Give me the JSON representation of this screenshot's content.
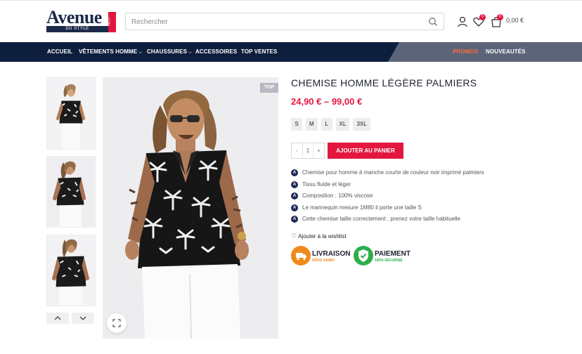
{
  "brand": {
    "logo_word": "Avenue",
    "logo_sub": "DU STYLE",
    "logo_tag": ".COM"
  },
  "search": {
    "placeholder": "Rechercher"
  },
  "header": {
    "wishlist_count": "0",
    "cart_count": "0",
    "cart_total": "0,00 €"
  },
  "nav": {
    "items": [
      {
        "label": "ACCUEIL",
        "has_dropdown": false
      },
      {
        "label": "VÊTEMENTS HOMME",
        "has_dropdown": true
      },
      {
        "label": "CHAUSSURES",
        "has_dropdown": true
      },
      {
        "label": "ACCESSOIRES",
        "has_dropdown": false
      },
      {
        "label": "TOP VENTES",
        "has_dropdown": false
      }
    ],
    "promo": "PROMOS",
    "new": "NOUVEAUTÉS"
  },
  "gallery": {
    "badge": "TOP",
    "thumbnail_count": 3
  },
  "product": {
    "title": "CHEMISE HOMME LÉGÈRE PALMIERS",
    "price": "24,90 € – 99,00 €",
    "sizes": [
      "S",
      "M",
      "L",
      "XL",
      "3XL"
    ],
    "quantity": "1",
    "qty_minus": "-",
    "qty_plus": "+",
    "add_to_cart": "AJOUTER AU PANIER",
    "features": [
      "Chemise pour homme  à manche courte de couleur noir imprimé palmiers",
      "Tissu fluide et léger",
      "Composition : 100% viscose",
      "Le mannequin mesure 1M80 il porte une taille S",
      "Cette chemise taille correctement , prenez votre taille habituelle"
    ],
    "wishlist": "Ajouter à la wishlist"
  },
  "badges": {
    "delivery_title": "LIVRAISON",
    "delivery_sub": "SOUS 24/48H",
    "payment_title": "PAIEMENT",
    "payment_sub": "100% SÉCURISÉ"
  },
  "colors": {
    "brand_navy": "#0e1e3d",
    "accent_red": "#e3173e",
    "promo_orange": "#ff6a3d",
    "delivery_orange": "#f08a1c",
    "payment_green": "#2eae4a"
  }
}
